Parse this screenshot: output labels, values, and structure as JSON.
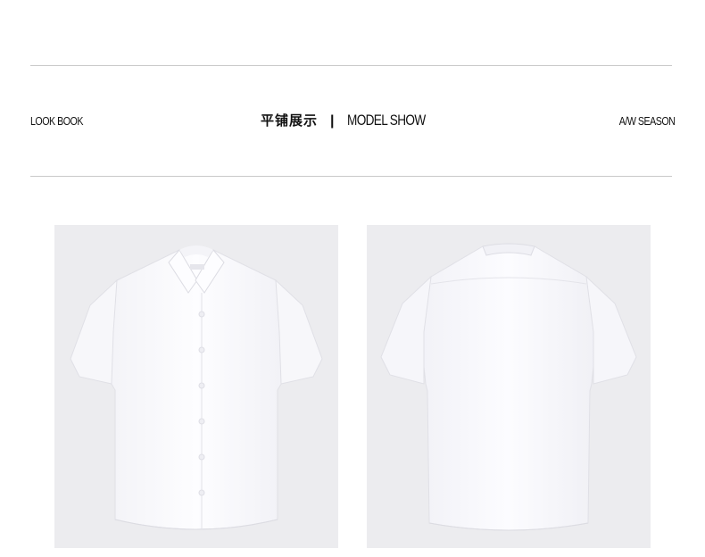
{
  "header": {
    "left_label": "LOOK BOOK",
    "title_cn": "平铺展示",
    "separator": "|",
    "title_en": "MODEL SHOW",
    "right_label": "A/W SEASON"
  },
  "images": [
    {
      "view": "front",
      "subject": "white short-sleeve shirt front"
    },
    {
      "view": "back",
      "subject": "white short-sleeve shirt back"
    }
  ],
  "colors": {
    "background": "#ffffff",
    "rule": "#c9c9c9",
    "photo_bg": "#ececef",
    "shirt": "#fbfbfd"
  }
}
